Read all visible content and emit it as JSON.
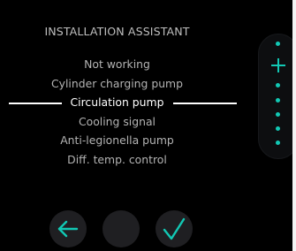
{
  "header": {
    "title": "INSTALLATION ASSISTANT"
  },
  "menu": {
    "items": [
      {
        "label": "Not working",
        "selected": false
      },
      {
        "label": "Cylinder charging pump",
        "selected": false
      },
      {
        "label": "Circulation pump",
        "selected": true
      },
      {
        "label": "Cooling signal",
        "selected": false
      },
      {
        "label": "Anti-legionella pump",
        "selected": false
      },
      {
        "label": "Diff. temp. control",
        "selected": false
      }
    ]
  },
  "scrollbar": {
    "icon": "plus-icon",
    "color": "#12c8b4"
  },
  "controls": {
    "back_icon": "arrow-left-icon",
    "middle_icon": "blank",
    "confirm_icon": "checkmark-icon",
    "accent_color": "#12c8b4"
  }
}
